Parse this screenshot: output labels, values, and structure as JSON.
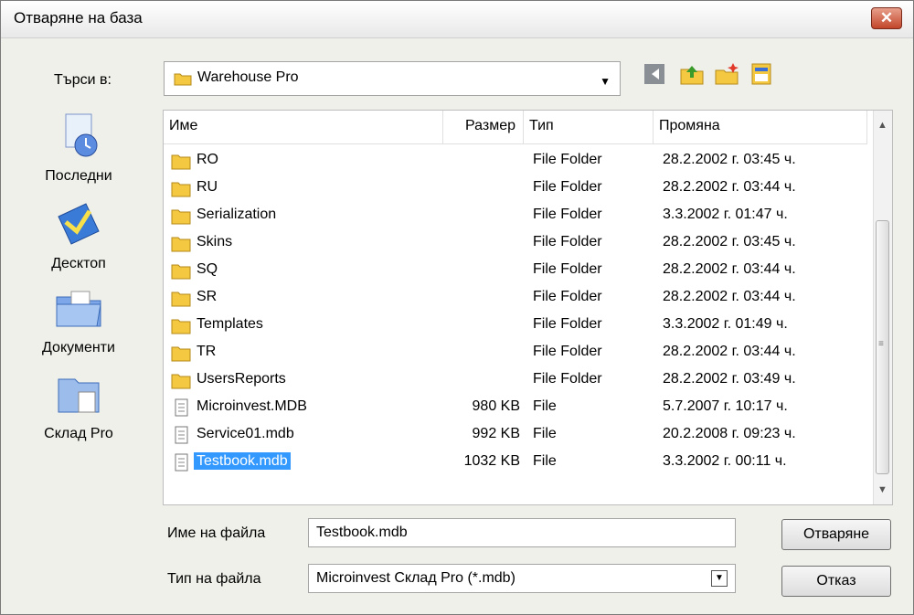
{
  "window": {
    "title": "Отваряне на база",
    "close_label": "✕"
  },
  "lookin": {
    "label": "Търси в:",
    "value": "Warehouse Pro"
  },
  "places": [
    {
      "label": "Последни",
      "icon": "recent-icon"
    },
    {
      "label": "Десктоп",
      "icon": "desktop-icon"
    },
    {
      "label": "Документи",
      "icon": "documents-icon"
    },
    {
      "label": "Склад Pro",
      "icon": "network-folder-icon"
    }
  ],
  "columns": {
    "name": "Име",
    "size": "Размер",
    "type": "Тип",
    "modified": "Промяна"
  },
  "files": [
    {
      "name": "RO",
      "size": "",
      "type": "File Folder",
      "modified": "28.2.2002 г. 03:45 ч.",
      "kind": "folder"
    },
    {
      "name": "RU",
      "size": "",
      "type": "File Folder",
      "modified": "28.2.2002 г. 03:44 ч.",
      "kind": "folder"
    },
    {
      "name": "Serialization",
      "size": "",
      "type": "File Folder",
      "modified": "3.3.2002 г. 01:47 ч.",
      "kind": "folder"
    },
    {
      "name": "Skins",
      "size": "",
      "type": "File Folder",
      "modified": "28.2.2002 г. 03:45 ч.",
      "kind": "folder"
    },
    {
      "name": "SQ",
      "size": "",
      "type": "File Folder",
      "modified": "28.2.2002 г. 03:44 ч.",
      "kind": "folder"
    },
    {
      "name": "SR",
      "size": "",
      "type": "File Folder",
      "modified": "28.2.2002 г. 03:44 ч.",
      "kind": "folder"
    },
    {
      "name": "Templates",
      "size": "",
      "type": "File Folder",
      "modified": "3.3.2002 г. 01:49 ч.",
      "kind": "folder"
    },
    {
      "name": "TR",
      "size": "",
      "type": "File Folder",
      "modified": "28.2.2002 г. 03:44 ч.",
      "kind": "folder"
    },
    {
      "name": "UsersReports",
      "size": "",
      "type": "File Folder",
      "modified": "28.2.2002 г. 03:49 ч.",
      "kind": "folder"
    },
    {
      "name": "Microinvest.MDB",
      "size": "980 KB",
      "type": "File",
      "modified": "5.7.2007 г. 10:17 ч.",
      "kind": "file"
    },
    {
      "name": "Service01.mdb",
      "size": "992 KB",
      "type": "File",
      "modified": "20.2.2008 г. 09:23 ч.",
      "kind": "file"
    },
    {
      "name": "Testbook.mdb",
      "size": "1032 KB",
      "type": "File",
      "modified": "3.3.2002 г. 00:11 ч.",
      "kind": "file",
      "selected": true
    }
  ],
  "filename": {
    "label": "Име на файла",
    "value": "Testbook.mdb"
  },
  "filetype": {
    "label": "Тип на файла",
    "value": "Microinvest Склад Pro (*.mdb)"
  },
  "buttons": {
    "open": "Отваряне",
    "cancel": "Отказ"
  },
  "colors": {
    "selection": "#3399FF",
    "folder": "#F5C842"
  }
}
